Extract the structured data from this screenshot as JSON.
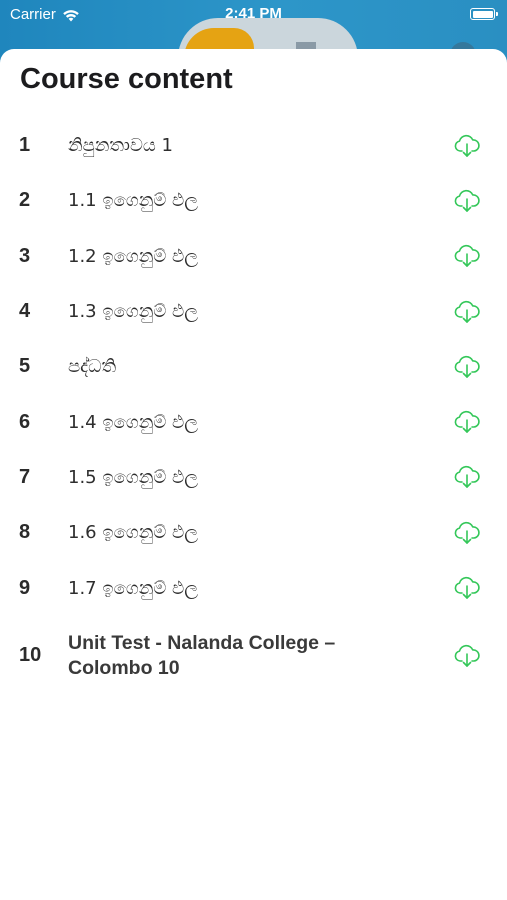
{
  "status_bar": {
    "carrier": "Carrier",
    "time": "2:41 PM"
  },
  "sheet": {
    "title": "Course content"
  },
  "accent_color": "#34c759",
  "lessons": [
    {
      "number": "1",
      "title": "නිපුනතාවය 1",
      "icon": "cloud-download-icon"
    },
    {
      "number": "2",
      "title": "1.1 ඉගෙනුම් ඵල",
      "icon": "cloud-download-icon"
    },
    {
      "number": "3",
      "title": "1.2 ඉගෙනුම් ඵල",
      "icon": "cloud-download-icon"
    },
    {
      "number": "4",
      "title": "1.3 ඉගෙනුම් ඵල",
      "icon": "cloud-download-icon"
    },
    {
      "number": "5",
      "title": "පද්ධති",
      "icon": "cloud-download-icon"
    },
    {
      "number": "6",
      "title": "1.4 ඉගෙනුම් ඵල",
      "icon": "cloud-download-icon"
    },
    {
      "number": "7",
      "title": "1.5 ඉගෙනුම් ඵල",
      "icon": "cloud-download-icon"
    },
    {
      "number": "8",
      "title": "1.6 ඉගෙනුම් ඵල",
      "icon": "cloud-download-icon"
    },
    {
      "number": "9",
      "title": "1.7 ඉගෙනුම් ඵල",
      "icon": "cloud-download-icon"
    },
    {
      "number": "10",
      "title": " Unit Test - Nalanda College – Colombo 10",
      "icon": "cloud-download-icon"
    }
  ]
}
